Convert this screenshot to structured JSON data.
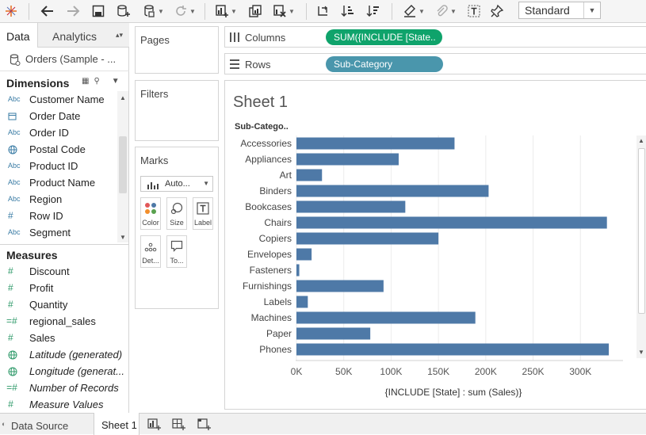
{
  "toolbar": {
    "view_select": "Standard",
    "icons": [
      "tableau-logo-icon",
      "back-icon",
      "forward-icon",
      "save-icon",
      "new-datasource-icon",
      "datasource-icon",
      "refresh-icon",
      "new-worksheet-icon",
      "duplicate-icon",
      "clear-icon",
      "swap-icon",
      "sort-ascending-icon",
      "sort-descending-icon",
      "highlight-icon",
      "paperclip-icon",
      "text-icon",
      "pin-icon"
    ]
  },
  "left_pane": {
    "tabs": {
      "data": "Data",
      "analytics": "Analytics"
    },
    "datasource": "Orders (Sample - ...",
    "dimensions_title": "Dimensions",
    "dimensions": [
      {
        "label": "Customer Name",
        "type": "Abc"
      },
      {
        "label": "Order Date",
        "type": "date"
      },
      {
        "label": "Order ID",
        "type": "Abc"
      },
      {
        "label": "Postal Code",
        "type": "geo"
      },
      {
        "label": "Product ID",
        "type": "Abc"
      },
      {
        "label": "Product Name",
        "type": "Abc"
      },
      {
        "label": "Region",
        "type": "Abc"
      },
      {
        "label": "Row ID",
        "type": "#"
      },
      {
        "label": "Segment",
        "type": "Abc"
      }
    ],
    "measures_title": "Measures",
    "measures": [
      {
        "label": "Discount",
        "type": "#",
        "italic": false
      },
      {
        "label": "Profit",
        "type": "#",
        "italic": false
      },
      {
        "label": "Quantity",
        "type": "#",
        "italic": false
      },
      {
        "label": "regional_sales",
        "type": "=#",
        "italic": false
      },
      {
        "label": "Sales",
        "type": "#",
        "italic": false
      },
      {
        "label": "Latitude (generated)",
        "type": "geo",
        "italic": true
      },
      {
        "label": "Longitude (generat...",
        "type": "geo",
        "italic": true
      },
      {
        "label": "Number of Records",
        "type": "=#",
        "italic": true
      },
      {
        "label": "Measure Values",
        "type": "#",
        "italic": true
      }
    ]
  },
  "cards": {
    "pages": "Pages",
    "filters": "Filters",
    "marks": "Marks",
    "mark_type": "Auto...",
    "mark_buttons": [
      "Color",
      "Size",
      "Label",
      "Det...",
      "To..."
    ]
  },
  "shelves": {
    "columns_label": "Columns",
    "columns_pill": "SUM({INCLUDE [State..",
    "rows_label": "Rows",
    "rows_pill": "Sub-Category"
  },
  "bottom_tabs": {
    "data_source": "Data Source",
    "sheet1": "Sheet 1"
  },
  "sheet": {
    "title": "Sheet 1"
  },
  "chart_data": {
    "type": "bar",
    "orientation": "horizontal",
    "row_header": "Sub-Catego..",
    "categories": [
      "Accessories",
      "Appliances",
      "Art",
      "Binders",
      "Bookcases",
      "Chairs",
      "Copiers",
      "Envelopes",
      "Fasteners",
      "Furnishings",
      "Labels",
      "Machines",
      "Paper",
      "Phones"
    ],
    "values": [
      167000,
      108000,
      27000,
      203000,
      115000,
      328000,
      150000,
      16000,
      3000,
      92000,
      12000,
      189000,
      78000,
      330000
    ],
    "xlabel": "{INCLUDE [State] : sum (Sales)}",
    "xlim": [
      0,
      345000
    ],
    "xticks": [
      0,
      50000,
      100000,
      150000,
      200000,
      250000,
      300000
    ],
    "xtick_labels": [
      "0K",
      "50K",
      "100K",
      "150K",
      "200K",
      "250K",
      "300K"
    ],
    "bar_color": "#4e79a7",
    "grid": true
  }
}
